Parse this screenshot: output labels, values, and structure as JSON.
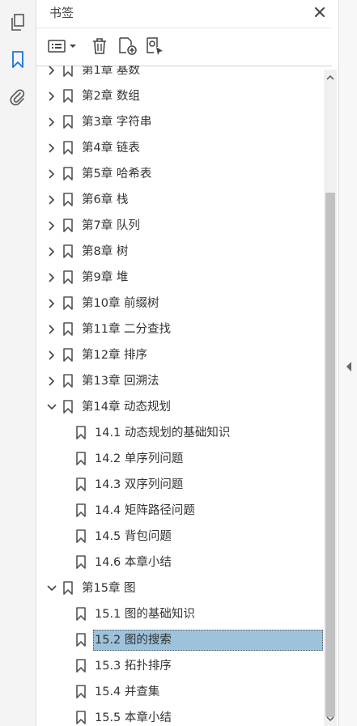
{
  "panel": {
    "title": "书签"
  },
  "tree": {
    "rows": [
      {
        "label": "第1章 基数",
        "level": 0,
        "expander": "collapsed"
      },
      {
        "label": "第2章 数组",
        "level": 0,
        "expander": "collapsed"
      },
      {
        "label": "第3章 字符串",
        "level": 0,
        "expander": "collapsed"
      },
      {
        "label": "第4章 链表",
        "level": 0,
        "expander": "collapsed"
      },
      {
        "label": "第5章 哈希表",
        "level": 0,
        "expander": "collapsed"
      },
      {
        "label": "第6章 栈",
        "level": 0,
        "expander": "collapsed"
      },
      {
        "label": "第7章 队列",
        "level": 0,
        "expander": "collapsed"
      },
      {
        "label": "第8章 树",
        "level": 0,
        "expander": "collapsed"
      },
      {
        "label": "第9章 堆",
        "level": 0,
        "expander": "collapsed"
      },
      {
        "label": "第10章 前缀树",
        "level": 0,
        "expander": "collapsed"
      },
      {
        "label": "第11章 二分查找",
        "level": 0,
        "expander": "collapsed"
      },
      {
        "label": "第12章 排序",
        "level": 0,
        "expander": "collapsed"
      },
      {
        "label": "第13章 回溯法",
        "level": 0,
        "expander": "collapsed"
      },
      {
        "label": "第14章 动态规划",
        "level": 0,
        "expander": "expanded"
      },
      {
        "label": "14.1 动态规划的基础知识",
        "level": 1,
        "expander": "none"
      },
      {
        "label": "14.2 单序列问题",
        "level": 1,
        "expander": "none"
      },
      {
        "label": "14.3 双序列问题",
        "level": 1,
        "expander": "none"
      },
      {
        "label": "14.4 矩阵路径问题",
        "level": 1,
        "expander": "none"
      },
      {
        "label": "14.5 背包问题",
        "level": 1,
        "expander": "none"
      },
      {
        "label": "14.6 本章小结",
        "level": 1,
        "expander": "none"
      },
      {
        "label": "第15章 图",
        "level": 0,
        "expander": "expanded"
      },
      {
        "label": "15.1 图的基础知识",
        "level": 1,
        "expander": "none"
      },
      {
        "label": "15.2 图的搜索",
        "level": 1,
        "expander": "none",
        "selected": true
      },
      {
        "label": "15.3 拓扑排序",
        "level": 1,
        "expander": "none"
      },
      {
        "label": "15.4 并查集",
        "level": 1,
        "expander": "none"
      },
      {
        "label": "15.5 本章小结",
        "level": 1,
        "expander": "none"
      }
    ]
  },
  "icons": {
    "pages": "pages-icon",
    "bookmarks": "bookmark-panel-icon",
    "attachments": "paperclip-icon",
    "close": "close-icon",
    "options": "options-menu-icon",
    "delete": "trash-icon",
    "new_bookmark": "new-bookmark-icon",
    "new_from_structure": "bookmark-from-structure-icon"
  },
  "colors": {
    "accent": "#1a73d9",
    "selection": "#9cc2dc",
    "icon": "#555555"
  }
}
